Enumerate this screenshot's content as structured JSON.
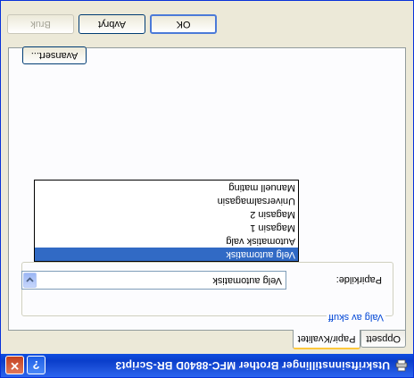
{
  "window": {
    "title": "Utskriftsinnstillinger Brother MFC-8840D BR-Script3",
    "help_label": "?",
    "close_label": "✕"
  },
  "tabs": [
    {
      "label": "Oppsett"
    },
    {
      "label": "Papir/Kvalitet"
    }
  ],
  "group": {
    "title": "Valg av skuff",
    "field_label": "Papirkilde:",
    "selected_value": "Velg automatisk",
    "options": [
      "Velg automatisk",
      "Automatisk valg",
      "Magasin 1",
      "Magasin 2",
      "Universalmagasin",
      "Manuell mating"
    ]
  },
  "buttons": {
    "advanced": "Avansert...",
    "ok": "OK",
    "cancel": "Avbryt",
    "apply": "Bruk"
  },
  "colors": {
    "titlebar": "#0a3ecb",
    "dialog_bg": "#ece9d8",
    "selection": "#316ac5",
    "active_tab_accent": "#ffc83c"
  },
  "icons": {
    "app": "printer-icon",
    "help": "help-icon",
    "close": "close-icon",
    "combo": "chevron-down-icon"
  }
}
